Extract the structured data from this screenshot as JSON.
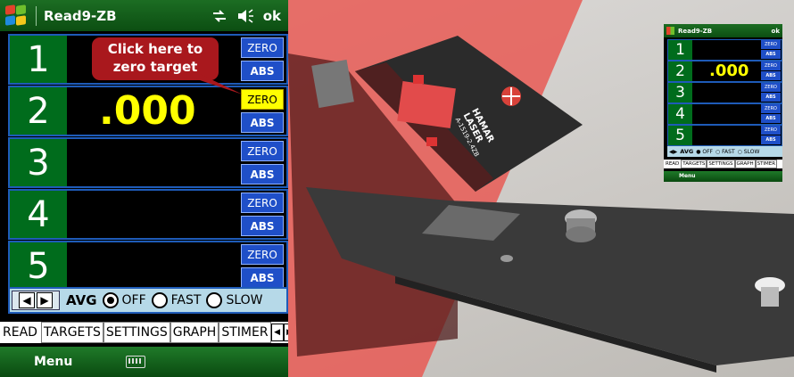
{
  "phone": {
    "title": "Read9-ZB",
    "status_ok": "ok",
    "rows": [
      {
        "number": "1",
        "value": "",
        "zero_label": "ZERO",
        "abs_label": "ABS",
        "zero_active": false
      },
      {
        "number": "2",
        "value": ".000",
        "zero_label": "ZERO",
        "abs_label": "ABS",
        "zero_active": true
      },
      {
        "number": "3",
        "value": "",
        "zero_label": "ZERO",
        "abs_label": "ABS",
        "zero_active": false
      },
      {
        "number": "4",
        "value": "",
        "zero_label": "ZERO",
        "abs_label": "ABS",
        "zero_active": false
      },
      {
        "number": "5",
        "value": "",
        "zero_label": "ZERO",
        "abs_label": "ABS",
        "zero_active": false
      }
    ],
    "avg": {
      "label": "AVG",
      "options": [
        {
          "label": "OFF",
          "selected": true
        },
        {
          "label": "FAST",
          "selected": false
        },
        {
          "label": "SLOW",
          "selected": false
        }
      ]
    },
    "tabs": [
      "READ",
      "TARGETS",
      "SETTINGS",
      "GRAPH",
      "STIMER"
    ],
    "menu_label": "Menu",
    "callout_line1": "Click here to",
    "callout_line2": "zero target"
  },
  "photo": {
    "device_brand_line1": "HAMAR",
    "device_brand_line2": "LASER",
    "device_model": "A-1519-2.4ZB"
  },
  "mini_phone": {
    "title": "Read9-ZB",
    "status_ok": "ok",
    "rows": [
      {
        "number": "1",
        "value": ""
      },
      {
        "number": "2",
        "value": ".000"
      },
      {
        "number": "3",
        "value": ""
      },
      {
        "number": "4",
        "value": ""
      },
      {
        "number": "5",
        "value": ""
      }
    ],
    "zero_label": "ZERO",
    "abs_label": "ABS",
    "avg_label": "AVG",
    "avg_options": [
      "OFF",
      "FAST",
      "SLOW"
    ],
    "tabs": [
      "READ",
      "TARGETS",
      "SETTINGS",
      "GRAPH",
      "STIMER"
    ],
    "menu_label": "Menu"
  },
  "colors": {
    "title_green": "#0c4e12",
    "row_number_green": "#006c1c",
    "readout_yellow": "#ffff00",
    "button_blue": "#1f4fc8",
    "callout_red": "#a9181d",
    "laser_red": "#e85a55",
    "avg_bar": "#b6d9e8"
  }
}
